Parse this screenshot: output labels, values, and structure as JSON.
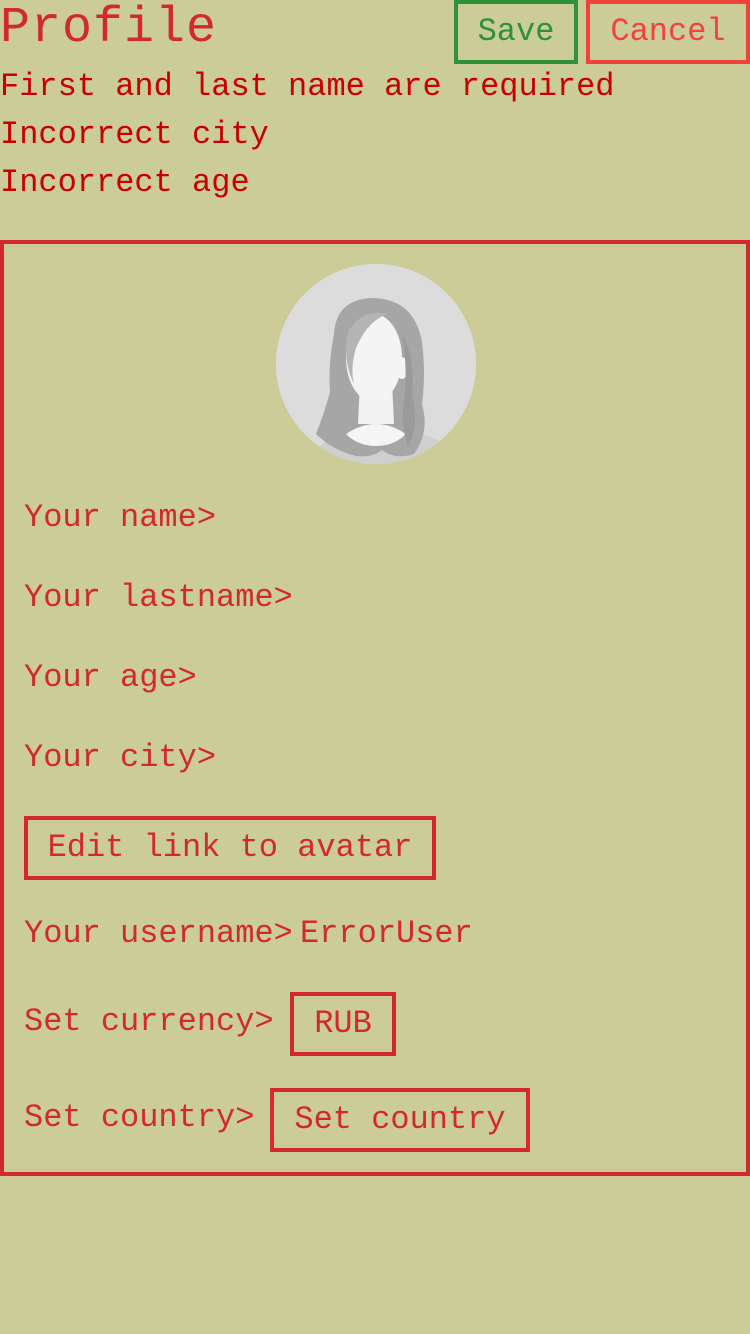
{
  "header": {
    "title": "Profile",
    "save_label": "Save",
    "cancel_label": "Cancel"
  },
  "errors": [
    "First and last name are required",
    "Incorrect city",
    "Incorrect age"
  ],
  "form": {
    "avatar_icon": "female-avatar-placeholder-icon",
    "name_label": "Your name>",
    "lastname_label": "Your lastname>",
    "age_label": "Your age>",
    "city_label": "Your city>",
    "edit_avatar_label": "Edit link to avatar",
    "username_label": "Your username>",
    "username_value": "ErrorUser",
    "currency_label": "Set currency>",
    "currency_value": "RUB",
    "country_label": "Set country>",
    "country_value": "Set country"
  },
  "colors": {
    "background": "#cccc99",
    "accent": "#d22a2a",
    "save": "#2e9135",
    "cancel": "#f0433d",
    "error": "#c80000"
  }
}
